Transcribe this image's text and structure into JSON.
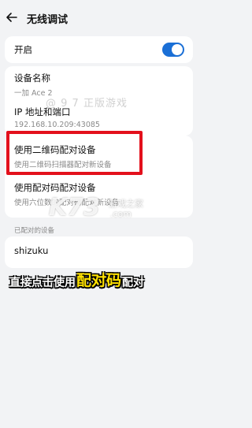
{
  "header": {
    "title": "无线调试",
    "back_icon": "arrow-left-icon"
  },
  "toggle": {
    "label": "开启",
    "state": "on",
    "color": "#1a6fd6"
  },
  "info": {
    "device_name_label": "设备名称",
    "device_name_value": "一加 Ace 2",
    "ip_label": "IP 地址和端口",
    "ip_value": "192.168.10.209:43085"
  },
  "pairing": {
    "qr_title": "使用二维码配对设备",
    "qr_sub": "使用二维码扫描器配对新设备",
    "code_title": "使用配对码配对设备",
    "code_sub": "使用六位数的配对码配对新设备"
  },
  "paired": {
    "section_label": "已配对的设备",
    "device": "shizuku"
  },
  "overlay": {
    "watermark_text": "@ 9 7 正版游戏",
    "logo_text": "K73",
    "logo_sub": "游戏之家",
    "logo_domain": ".com",
    "caption_part1": "直接点击使用",
    "caption_part2": "配对码",
    "caption_part3": "配对",
    "highlight_color": "#e3101c",
    "caption_accent": "#ffe100"
  }
}
